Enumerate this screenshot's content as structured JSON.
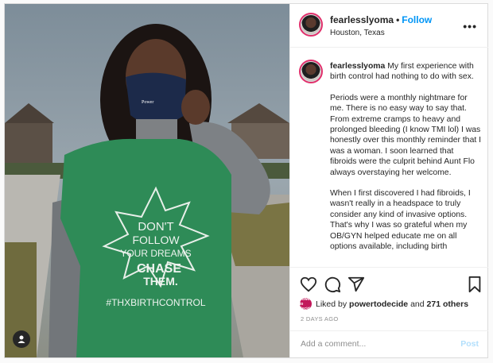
{
  "post": {
    "username": "fearlesslyoma",
    "separator": "•",
    "follow_label": "Follow",
    "location": "Houston, Texas",
    "more_label": "•••"
  },
  "caption": {
    "username": "fearlesslyoma",
    "p1": "My first experience with birth control had nothing to do with sex.",
    "p2": "Periods were a monthly nightmare for me. There is no easy way to say that. From extreme cramps to heavy and prolonged bleeding (I know TMI lol) I was honestly over this monthly reminder that I was a woman. I soon learned that fibroids were the culprit behind Aunt Flo always overstaying her welcome.",
    "p3": "When I first discovered I had fibroids, I wasn't really in a headspace to truly consider any kind of invasive options. That's why I was so grateful when my OB/GYN helped educate me on all options available, including birth"
  },
  "shirt": {
    "line1": "DON'T",
    "line2": "FOLLOW",
    "line3": "YOUR DREAMS",
    "line4": "CHASE",
    "line5": "THEM.",
    "hashtag": "#THXBIRTHCONTROL"
  },
  "mask_text": "Power to Decide",
  "likes": {
    "prefix": "Liked by",
    "user": "powertodecide",
    "middle": "and",
    "count": "271 others",
    "avatar_text": "power to decide"
  },
  "date": "2 DAYS AGO",
  "comment": {
    "placeholder": "Add a comment...",
    "post_label": "Post"
  },
  "colors": {
    "accent": "#0095f6",
    "shirt": "#2e8b57",
    "avatar_ring": "#e1306c"
  },
  "icons": [
    "heart-icon",
    "comment-icon",
    "share-icon",
    "bookmark-icon",
    "more-icon",
    "user-tag-icon"
  ]
}
